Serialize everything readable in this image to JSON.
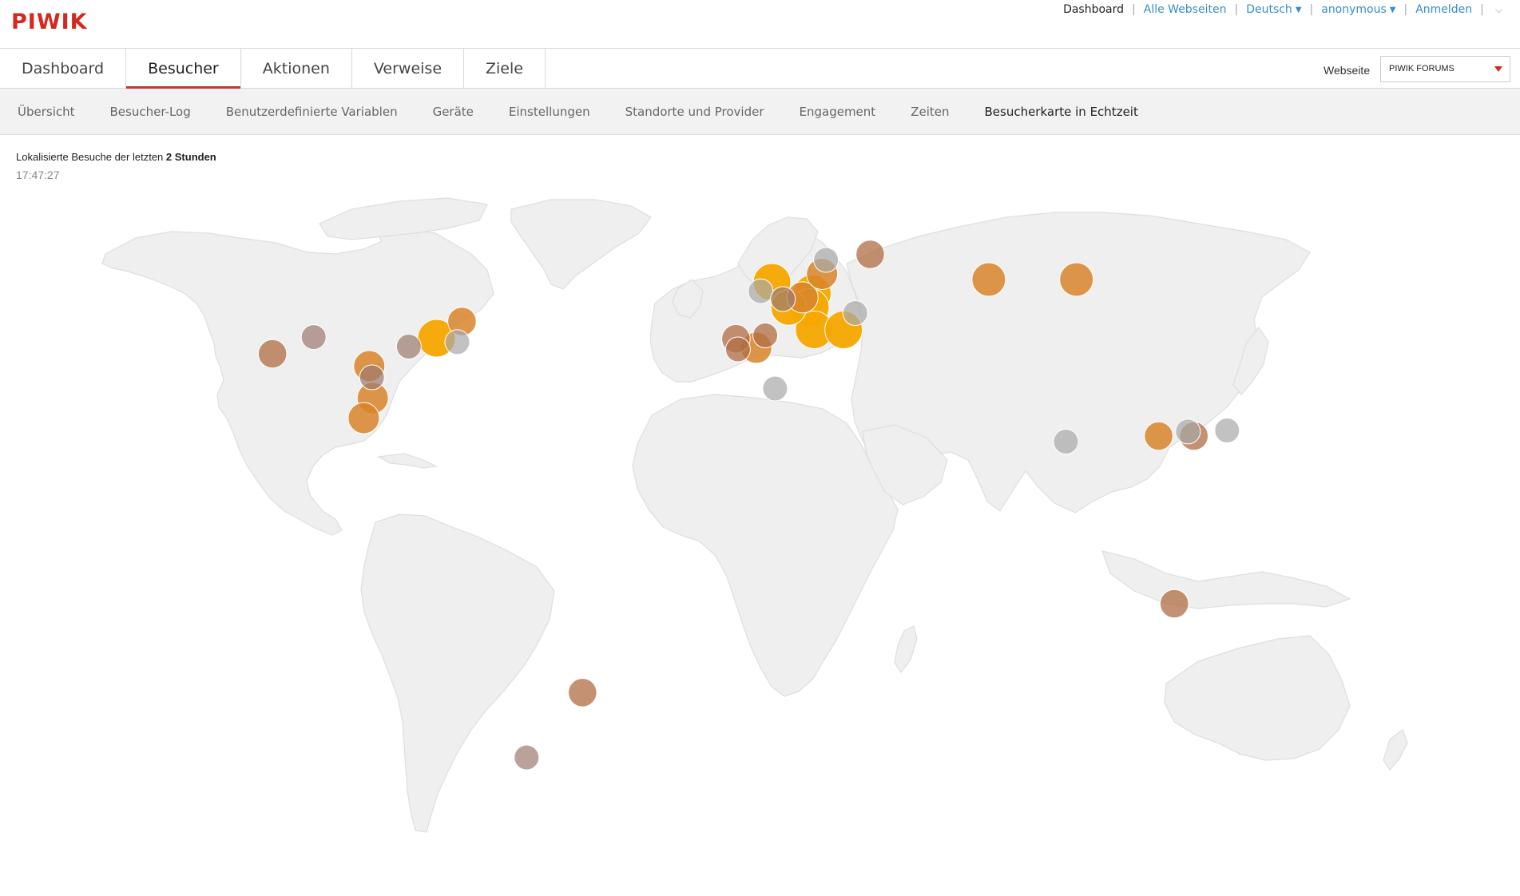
{
  "brand": {
    "logo_text": "PIWIK"
  },
  "top_nav": {
    "dashboard": "Dashboard",
    "all_websites": "Alle Webseiten",
    "language": "Deutsch",
    "user": "anonymous",
    "login": "Anmelden"
  },
  "main_menu": {
    "items": [
      {
        "label": "Dashboard"
      },
      {
        "label": "Besucher"
      },
      {
        "label": "Aktionen"
      },
      {
        "label": "Verweise"
      },
      {
        "label": "Ziele"
      }
    ],
    "active": "Besucher"
  },
  "site_selector": {
    "label": "Webseite",
    "value": "PIWIK FORUMS"
  },
  "sub_menu": {
    "items": [
      {
        "label": "Übersicht"
      },
      {
        "label": "Besucher-Log"
      },
      {
        "label": "Benutzerdefinierte Variablen"
      },
      {
        "label": "Geräte"
      },
      {
        "label": "Einstellungen"
      },
      {
        "label": "Standorte und Provider"
      },
      {
        "label": "Engagement"
      },
      {
        "label": "Zeiten"
      },
      {
        "label": "Besucherkarte in Echtzeit"
      }
    ],
    "active": "Besucherkarte in Echtzeit"
  },
  "realtime_map": {
    "caption_prefix": "Lokalisierte Besuche der letzten",
    "caption_period": "2 Stunden",
    "clock": "17:47:27",
    "colors": {
      "recent": "#f5a700",
      "medium": "#d8842a",
      "old": "#b06e44",
      "faded": "#9c7b70",
      "stale": "#a8a8a8",
      "land": "#efefef",
      "accent": "#c0392b"
    },
    "visits": [
      {
        "lon": -122.4,
        "lat": 37.7,
        "age": "old",
        "visits": 2
      },
      {
        "lon": -111.9,
        "lat": 40.7,
        "age": "faded",
        "visits": 1
      },
      {
        "lon": -97.7,
        "lat": 35.5,
        "age": "medium",
        "visits": 3
      },
      {
        "lon": -97.0,
        "lat": 33.5,
        "age": "faded",
        "visits": 1
      },
      {
        "lon": -96.8,
        "lat": 29.8,
        "age": "medium",
        "visits": 3
      },
      {
        "lon": -99.1,
        "lat": 26.2,
        "age": "medium",
        "visits": 3
      },
      {
        "lon": -87.6,
        "lat": 39.0,
        "age": "faded",
        "visits": 1
      },
      {
        "lon": -80.5,
        "lat": 40.5,
        "age": "recent",
        "visits": 6
      },
      {
        "lon": -74.0,
        "lat": 43.5,
        "age": "medium",
        "visits": 2
      },
      {
        "lon": -75.2,
        "lat": 39.8,
        "age": "stale",
        "visits": 1
      },
      {
        "lon": -4.0,
        "lat": 40.4,
        "age": "old",
        "visits": 2
      },
      {
        "lon": -3.5,
        "lat": 38.5,
        "age": "old",
        "visits": 1
      },
      {
        "lon": 1.2,
        "lat": 38.8,
        "age": "medium",
        "visits": 3
      },
      {
        "lon": 3.5,
        "lat": 41.0,
        "age": "old",
        "visits": 1
      },
      {
        "lon": 6.0,
        "lat": 31.5,
        "age": "stale",
        "visits": 1
      },
      {
        "lon": 2.3,
        "lat": 48.9,
        "age": "stale",
        "visits": 1
      },
      {
        "lon": 5.2,
        "lat": 50.5,
        "age": "recent",
        "visits": 6
      },
      {
        "lon": 9.5,
        "lat": 46.0,
        "age": "recent",
        "visits": 5
      },
      {
        "lon": 8.0,
        "lat": 47.5,
        "age": "faded",
        "visits": 1
      },
      {
        "lon": 13.0,
        "lat": 47.8,
        "age": "medium",
        "visits": 3
      },
      {
        "lon": 15.5,
        "lat": 48.5,
        "age": "recent",
        "visits": 6
      },
      {
        "lon": 15.0,
        "lat": 46.0,
        "age": "recent",
        "visits": 6
      },
      {
        "lon": 18.0,
        "lat": 52.0,
        "age": "medium",
        "visits": 3
      },
      {
        "lon": 19.0,
        "lat": 54.5,
        "age": "stale",
        "visits": 1
      },
      {
        "lon": 16.0,
        "lat": 42.0,
        "age": "recent",
        "visits": 6
      },
      {
        "lon": 23.5,
        "lat": 42.0,
        "age": "recent",
        "visits": 6
      },
      {
        "lon": 26.5,
        "lat": 45.0,
        "age": "stale",
        "visits": 1
      },
      {
        "lon": 30.3,
        "lat": 55.5,
        "age": "old",
        "visits": 2
      },
      {
        "lon": 60.6,
        "lat": 51.0,
        "age": "medium",
        "visits": 4
      },
      {
        "lon": 83.0,
        "lat": 51.0,
        "age": "medium",
        "visits": 4
      },
      {
        "lon": 80.3,
        "lat": 22.0,
        "age": "stale",
        "visits": 1
      },
      {
        "lon": 104.0,
        "lat": 23.0,
        "age": "medium",
        "visits": 2
      },
      {
        "lon": 113.0,
        "lat": 23.0,
        "age": "old",
        "visits": 2
      },
      {
        "lon": 111.5,
        "lat": 23.8,
        "age": "stale",
        "visits": 1
      },
      {
        "lon": 121.5,
        "lat": 24.0,
        "age": "stale",
        "visits": 1
      },
      {
        "lon": 108.0,
        "lat": -7.0,
        "age": "old",
        "visits": 2
      },
      {
        "lon": -43.2,
        "lat": -22.9,
        "age": "old",
        "visits": 2
      },
      {
        "lon": -57.5,
        "lat": -34.5,
        "age": "faded",
        "visits": 1
      }
    ]
  }
}
